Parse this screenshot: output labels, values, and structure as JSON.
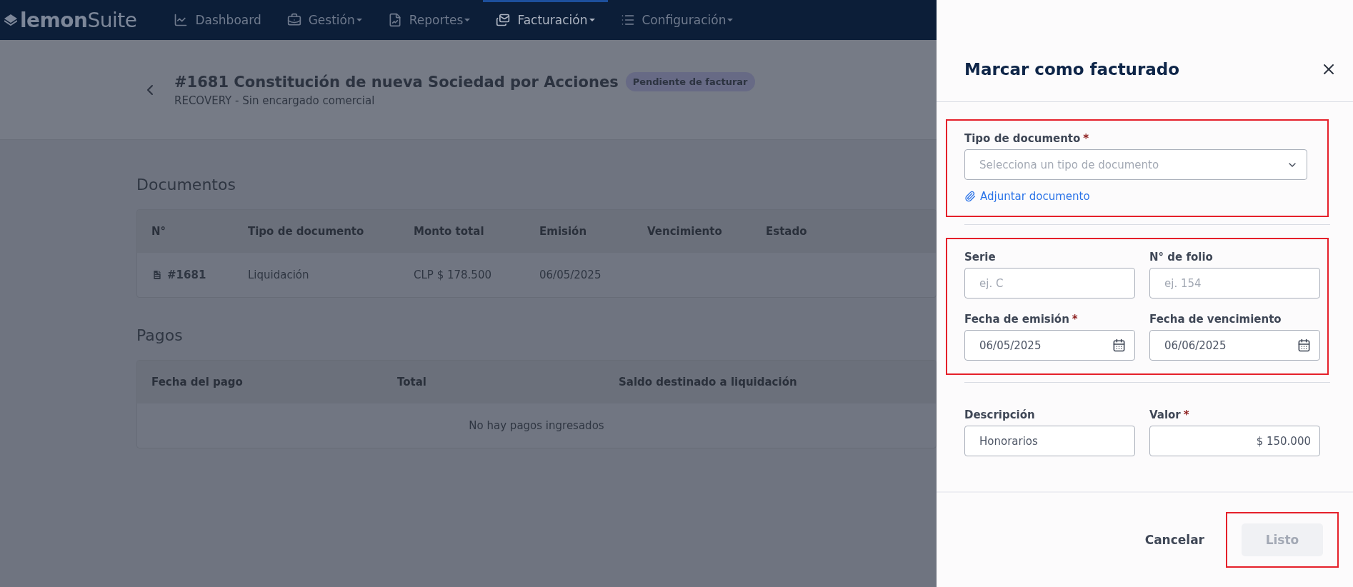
{
  "nav": {
    "logo": "**lemon**Suite",
    "items": [
      {
        "label": "Dashboard",
        "dropdown": false,
        "selected": false
      },
      {
        "label": "Gestión",
        "dropdown": true,
        "selected": false
      },
      {
        "label": "Reportes",
        "dropdown": true,
        "selected": false
      },
      {
        "label": "Facturación",
        "dropdown": true,
        "selected": true
      },
      {
        "label": "Configuración",
        "dropdown": true,
        "selected": false
      }
    ]
  },
  "header": {
    "title": "#1681 Constitución de nueva Sociedad por Acciones",
    "badge": "Pendiente de facturar",
    "subtitle": "RECOVERY - Sin encargado comercial"
  },
  "documents": {
    "heading": "Documentos",
    "columns": [
      "N°",
      "Tipo de documento",
      "Monto total",
      "Emisión",
      "Vencimiento",
      "Estado"
    ],
    "rows": [
      {
        "number": "#1681",
        "type": "Liquidación",
        "amount": "CLP $ 178.500",
        "issued": "06/05/2025"
      }
    ]
  },
  "payments": {
    "heading": "Pagos",
    "columns": [
      "Fecha del pago",
      "Total",
      "Saldo destinado a liquidación"
    ],
    "empty": "No hay pagos ingresados"
  },
  "drawer": {
    "title": "Marcar como facturado",
    "sections": [
      {
        "highlighted": true,
        "fields": [
          {
            "kind": "select",
            "label": "Tipo de documento",
            "required_mark": "*",
            "placeholder": "Selecciona un tipo de documento"
          }
        ],
        "link": "Adjuntar documento"
      },
      {
        "highlighted": true,
        "fields": [
          {
            "kind": "text",
            "label": "Serie",
            "placeholder": "ej. C"
          },
          {
            "kind": "text",
            "label": "N° de folio",
            "placeholder": "ej. 154"
          },
          {
            "kind": "date",
            "label": "Fecha de emisión",
            "required_mark": "*",
            "value": "06/05/2025"
          },
          {
            "kind": "date",
            "label": "Fecha de vencimiento",
            "value": "06/06/2025"
          }
        ]
      },
      {
        "highlighted": false,
        "fields": [
          {
            "kind": "text",
            "label": "Descripción",
            "value": "Honorarios"
          },
          {
            "kind": "money",
            "label": "Valor",
            "required_mark": "*",
            "value": "$ 150.000"
          }
        ]
      }
    ],
    "cancel": "Cancelar",
    "confirm": {
      "label": "Listo",
      "disabled": true,
      "highlighted": true
    }
  }
}
